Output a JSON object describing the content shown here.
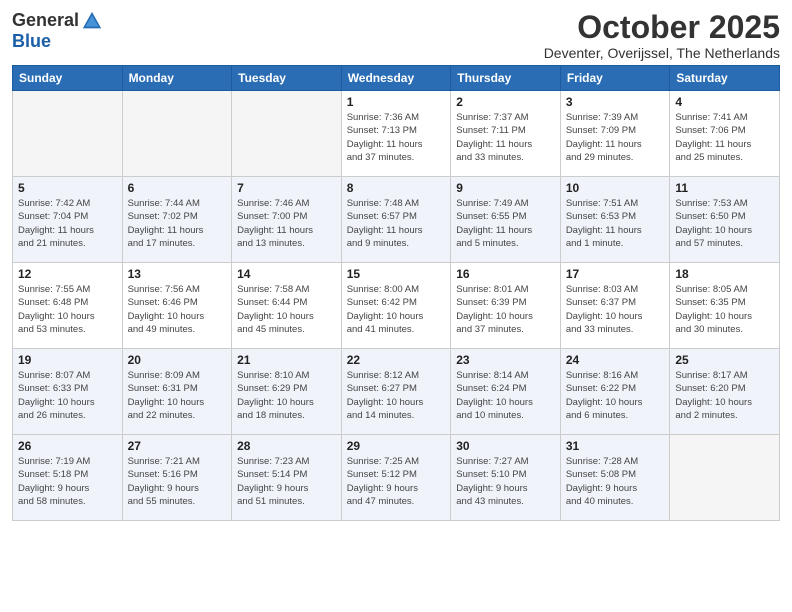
{
  "header": {
    "logo_general": "General",
    "logo_blue": "Blue",
    "month": "October 2025",
    "location": "Deventer, Overijssel, The Netherlands"
  },
  "weekdays": [
    "Sunday",
    "Monday",
    "Tuesday",
    "Wednesday",
    "Thursday",
    "Friday",
    "Saturday"
  ],
  "weeks": [
    [
      {
        "day": "",
        "info": ""
      },
      {
        "day": "",
        "info": ""
      },
      {
        "day": "",
        "info": ""
      },
      {
        "day": "1",
        "info": "Sunrise: 7:36 AM\nSunset: 7:13 PM\nDaylight: 11 hours\nand 37 minutes."
      },
      {
        "day": "2",
        "info": "Sunrise: 7:37 AM\nSunset: 7:11 PM\nDaylight: 11 hours\nand 33 minutes."
      },
      {
        "day": "3",
        "info": "Sunrise: 7:39 AM\nSunset: 7:09 PM\nDaylight: 11 hours\nand 29 minutes."
      },
      {
        "day": "4",
        "info": "Sunrise: 7:41 AM\nSunset: 7:06 PM\nDaylight: 11 hours\nand 25 minutes."
      }
    ],
    [
      {
        "day": "5",
        "info": "Sunrise: 7:42 AM\nSunset: 7:04 PM\nDaylight: 11 hours\nand 21 minutes."
      },
      {
        "day": "6",
        "info": "Sunrise: 7:44 AM\nSunset: 7:02 PM\nDaylight: 11 hours\nand 17 minutes."
      },
      {
        "day": "7",
        "info": "Sunrise: 7:46 AM\nSunset: 7:00 PM\nDaylight: 11 hours\nand 13 minutes."
      },
      {
        "day": "8",
        "info": "Sunrise: 7:48 AM\nSunset: 6:57 PM\nDaylight: 11 hours\nand 9 minutes."
      },
      {
        "day": "9",
        "info": "Sunrise: 7:49 AM\nSunset: 6:55 PM\nDaylight: 11 hours\nand 5 minutes."
      },
      {
        "day": "10",
        "info": "Sunrise: 7:51 AM\nSunset: 6:53 PM\nDaylight: 11 hours\nand 1 minute."
      },
      {
        "day": "11",
        "info": "Sunrise: 7:53 AM\nSunset: 6:50 PM\nDaylight: 10 hours\nand 57 minutes."
      }
    ],
    [
      {
        "day": "12",
        "info": "Sunrise: 7:55 AM\nSunset: 6:48 PM\nDaylight: 10 hours\nand 53 minutes."
      },
      {
        "day": "13",
        "info": "Sunrise: 7:56 AM\nSunset: 6:46 PM\nDaylight: 10 hours\nand 49 minutes."
      },
      {
        "day": "14",
        "info": "Sunrise: 7:58 AM\nSunset: 6:44 PM\nDaylight: 10 hours\nand 45 minutes."
      },
      {
        "day": "15",
        "info": "Sunrise: 8:00 AM\nSunset: 6:42 PM\nDaylight: 10 hours\nand 41 minutes."
      },
      {
        "day": "16",
        "info": "Sunrise: 8:01 AM\nSunset: 6:39 PM\nDaylight: 10 hours\nand 37 minutes."
      },
      {
        "day": "17",
        "info": "Sunrise: 8:03 AM\nSunset: 6:37 PM\nDaylight: 10 hours\nand 33 minutes."
      },
      {
        "day": "18",
        "info": "Sunrise: 8:05 AM\nSunset: 6:35 PM\nDaylight: 10 hours\nand 30 minutes."
      }
    ],
    [
      {
        "day": "19",
        "info": "Sunrise: 8:07 AM\nSunset: 6:33 PM\nDaylight: 10 hours\nand 26 minutes."
      },
      {
        "day": "20",
        "info": "Sunrise: 8:09 AM\nSunset: 6:31 PM\nDaylight: 10 hours\nand 22 minutes."
      },
      {
        "day": "21",
        "info": "Sunrise: 8:10 AM\nSunset: 6:29 PM\nDaylight: 10 hours\nand 18 minutes."
      },
      {
        "day": "22",
        "info": "Sunrise: 8:12 AM\nSunset: 6:27 PM\nDaylight: 10 hours\nand 14 minutes."
      },
      {
        "day": "23",
        "info": "Sunrise: 8:14 AM\nSunset: 6:24 PM\nDaylight: 10 hours\nand 10 minutes."
      },
      {
        "day": "24",
        "info": "Sunrise: 8:16 AM\nSunset: 6:22 PM\nDaylight: 10 hours\nand 6 minutes."
      },
      {
        "day": "25",
        "info": "Sunrise: 8:17 AM\nSunset: 6:20 PM\nDaylight: 10 hours\nand 2 minutes."
      }
    ],
    [
      {
        "day": "26",
        "info": "Sunrise: 7:19 AM\nSunset: 5:18 PM\nDaylight: 9 hours\nand 58 minutes."
      },
      {
        "day": "27",
        "info": "Sunrise: 7:21 AM\nSunset: 5:16 PM\nDaylight: 9 hours\nand 55 minutes."
      },
      {
        "day": "28",
        "info": "Sunrise: 7:23 AM\nSunset: 5:14 PM\nDaylight: 9 hours\nand 51 minutes."
      },
      {
        "day": "29",
        "info": "Sunrise: 7:25 AM\nSunset: 5:12 PM\nDaylight: 9 hours\nand 47 minutes."
      },
      {
        "day": "30",
        "info": "Sunrise: 7:27 AM\nSunset: 5:10 PM\nDaylight: 9 hours\nand 43 minutes."
      },
      {
        "day": "31",
        "info": "Sunrise: 7:28 AM\nSunset: 5:08 PM\nDaylight: 9 hours\nand 40 minutes."
      },
      {
        "day": "",
        "info": ""
      }
    ]
  ]
}
